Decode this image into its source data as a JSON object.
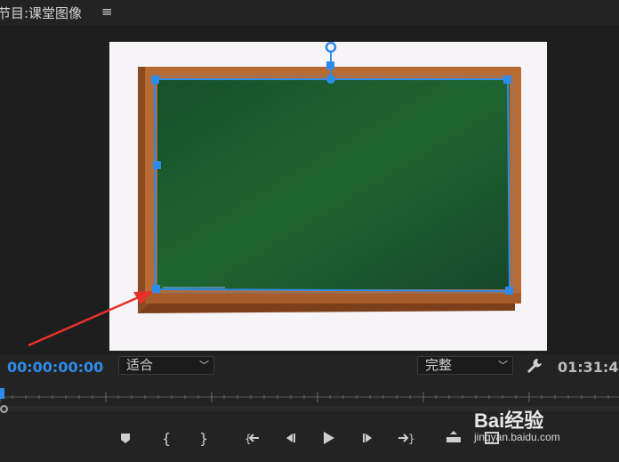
{
  "panel": {
    "title": "节目:课堂图像",
    "menu_icon": "hamburger-menu-icon"
  },
  "canvas": {
    "frame_background": "#f6f4f6",
    "board_color": "#1f5a2b",
    "frame_wood_color": "#b86a33",
    "selection_color": "#2d8ceb",
    "annotation_arrow_color": "#e8302a"
  },
  "controls": {
    "current_timecode": "00:00:00:00",
    "zoom_select": "适合",
    "quality_select": "完整",
    "settings_icon": "wrench-icon",
    "duration_timecode": "01:31:4"
  },
  "transport": {
    "buttons": [
      "add-marker-icon",
      "mark-in-icon",
      "mark-out-icon",
      "go-to-in-icon",
      "step-back-icon",
      "play-icon",
      "step-forward-icon",
      "go-to-out-icon",
      "lift-icon",
      "export-frame-icon"
    ]
  },
  "watermark": {
    "brand": "Bai经验",
    "url": "jingyan.baidu.com"
  }
}
